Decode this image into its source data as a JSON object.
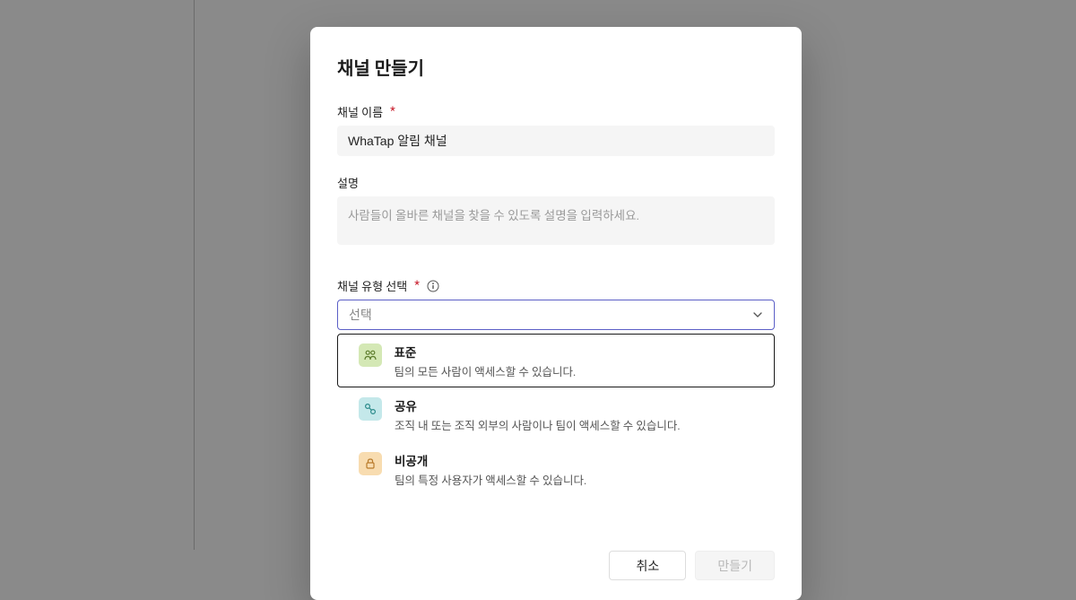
{
  "modal": {
    "title": "채널 만들기",
    "channel_name": {
      "label": "채널 이름",
      "value": "WhaTap 알림 채널"
    },
    "description": {
      "label": "설명",
      "placeholder": "사람들이 올바른 채널을 찾을 수 있도록 설명을 입력하세요."
    },
    "channel_type": {
      "label": "채널 유형 선택",
      "placeholder": "선택",
      "options": [
        {
          "title": "표준",
          "desc": "팀의 모든 사람이 액세스할 수 있습니다."
        },
        {
          "title": "공유",
          "desc": "조직 내 또는 조직 외부의 사람이나 팀이 액세스할 수 있습니다."
        },
        {
          "title": "비공개",
          "desc": "팀의 특정 사용자가 액세스할 수 있습니다."
        }
      ]
    },
    "footer": {
      "cancel": "취소",
      "create": "만들기"
    }
  }
}
